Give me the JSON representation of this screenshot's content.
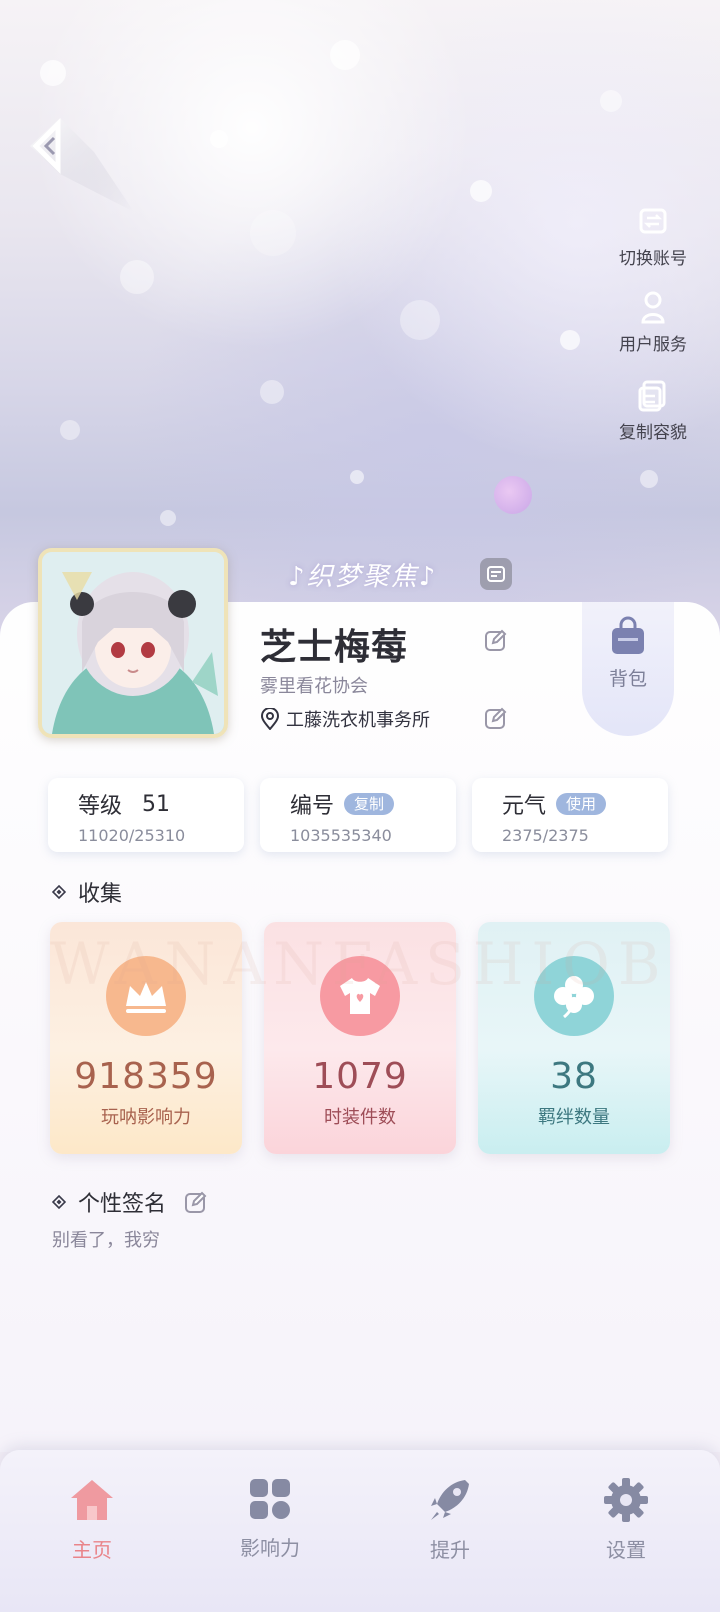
{
  "side_actions": [
    {
      "label": "切换账号",
      "icon": "switch-account-icon"
    },
    {
      "label": "用户服务",
      "icon": "user-service-icon"
    },
    {
      "label": "复制容貌",
      "icon": "copy-appearance-icon"
    }
  ],
  "brand": {
    "text": "♪织梦聚焦♪"
  },
  "profile": {
    "name": "芝士梅莓",
    "guild": "雾里看花协会",
    "location": "工藤洗衣机事务所"
  },
  "bag": {
    "label": "背包"
  },
  "stats": {
    "level": {
      "label": "等级",
      "value": "51",
      "sub": "11020/25310"
    },
    "id": {
      "label": "编号",
      "action": "复制",
      "sub": "1035535340"
    },
    "energy": {
      "label": "元气",
      "action": "使用",
      "sub": "2375/2375"
    }
  },
  "collection": {
    "title": "收集",
    "watermark": "WANANFASHIOBOND",
    "items": [
      {
        "value": "918359",
        "label": "玩呐影响力",
        "icon": "crown-icon"
      },
      {
        "value": "1079",
        "label": "时装件数",
        "icon": "tshirt-icon"
      },
      {
        "value": "38",
        "label": "羁绊数量",
        "icon": "clover-icon"
      }
    ]
  },
  "signature": {
    "title": "个性签名",
    "text": "别看了，我穷"
  },
  "nav": [
    {
      "label": "主页",
      "icon": "home-icon",
      "active": true
    },
    {
      "label": "影响力",
      "icon": "grid-icon",
      "active": false
    },
    {
      "label": "提升",
      "icon": "rocket-icon",
      "active": false
    },
    {
      "label": "设置",
      "icon": "gear-icon",
      "active": false
    }
  ],
  "colors": {
    "active_nav": "#e9848a",
    "inactive_nav": "#8d8fa3",
    "pill": "#9fb6de"
  }
}
